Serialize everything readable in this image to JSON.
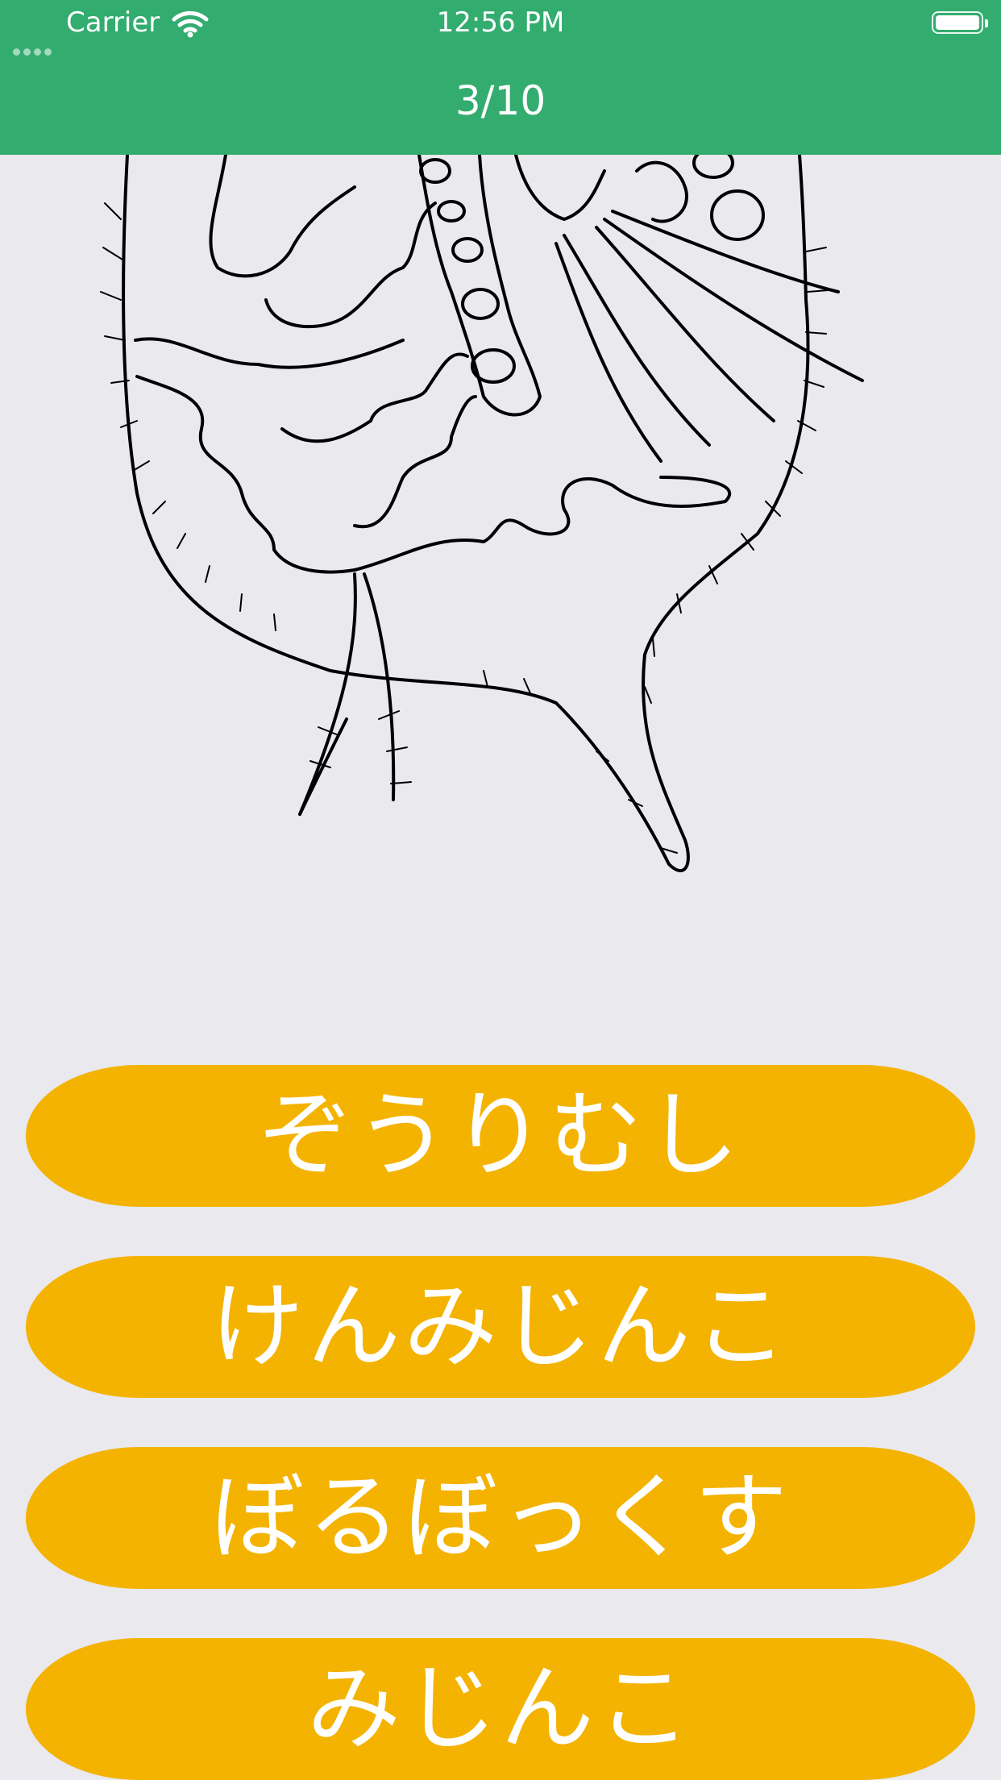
{
  "status_bar": {
    "carrier": "Carrier",
    "time": "12:56 PM",
    "signal_icon": "signal-dots-icon",
    "wifi_icon": "wifi-icon",
    "battery_icon": "battery-icon"
  },
  "header": {
    "progress": "3/10",
    "background_color": "#33ac6f"
  },
  "question": {
    "image": "plankton-line-drawing"
  },
  "answers": [
    {
      "label": "ぞうりむし"
    },
    {
      "label": "けんみじんこ"
    },
    {
      "label": "ぼるぼっくす"
    },
    {
      "label": "みじんこ"
    }
  ],
  "colors": {
    "answer_button": "#f4b300",
    "page_background": "#e9e9ee",
    "text": "#ffffff"
  }
}
